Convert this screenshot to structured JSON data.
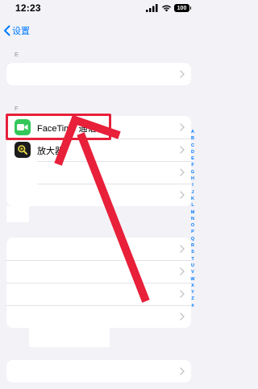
{
  "status_bar": {
    "time": "12:23",
    "battery": "100",
    "icons": [
      "signal-icon",
      "wifi-icon",
      "battery-icon"
    ]
  },
  "nav": {
    "back_label": "设置",
    "icon": "chevron-left-icon"
  },
  "sections": [
    {
      "header": "E",
      "rows": [
        {
          "label": ""
        }
      ]
    },
    {
      "header": "F",
      "rows": [
        {
          "label": "FaceTime 通话",
          "icon": "facetime-icon"
        },
        {
          "label": "放大器",
          "icon": "magnifier-icon"
        },
        {
          "label": ""
        },
        {
          "label": ""
        }
      ]
    }
  ],
  "index_letters": [
    "A",
    "B",
    "C",
    "D",
    "E",
    "F",
    "G",
    "H",
    "I",
    "J",
    "K",
    "L",
    "M",
    "N",
    "O",
    "P",
    "Q",
    "R",
    "S",
    "T",
    "U",
    "V",
    "W",
    "X",
    "Y",
    "Z",
    "#"
  ],
  "annotation": {
    "color": "#e8203a"
  },
  "colors": {
    "accent": "#007aff",
    "background": "#f2f2f7",
    "facetime_green": "#33c759"
  }
}
